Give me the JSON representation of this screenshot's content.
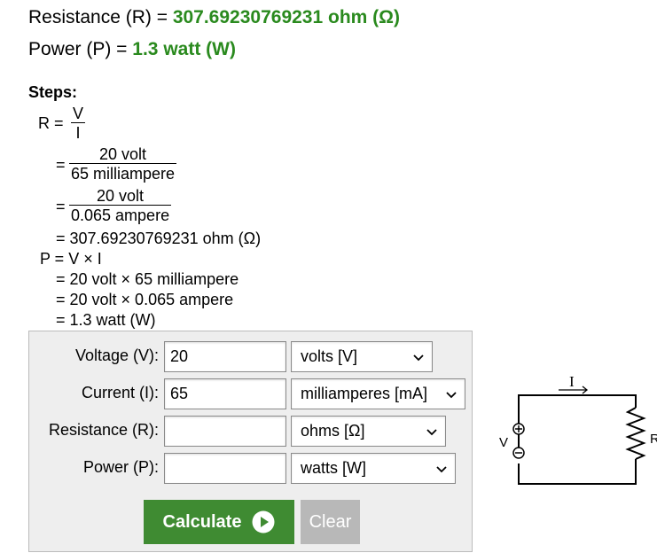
{
  "results": {
    "resistance_label": "Resistance (R) = ",
    "resistance_value": "307.69230769231 ohm (Ω)",
    "power_label": "Power (P) = ",
    "power_value": "1.3 watt (W)"
  },
  "steps": {
    "title": "Steps:",
    "r_prefix": "R =",
    "r_frac_num": "V",
    "r_frac_den": "I",
    "eq": "=",
    "f1_num": "20 volt",
    "f1_den": "65 milliampere",
    "f2_num": "20 volt",
    "f2_den": "0.065 ampere",
    "r_result": "= 307.69230769231 ohm (Ω)",
    "p_formula": "P = V × I",
    "p_step1": "= 20 volt × 65 milliampere",
    "p_step2": "= 20 volt × 0.065 ampere",
    "p_result": "= 1.3 watt (W)"
  },
  "form": {
    "voltage_label": "Voltage (V):",
    "voltage_value": "20",
    "voltage_unit": "volts [V]",
    "current_label": "Current (I):",
    "current_value": "65",
    "current_unit": "milliamperes [mA]",
    "resistance_label": "Resistance (R):",
    "resistance_value": "",
    "resistance_unit": "ohms [Ω]",
    "power_label": "Power (P):",
    "power_value": "",
    "power_unit": "watts [W]",
    "calculate_label": "Calculate",
    "clear_label": "Clear"
  },
  "diagram": {
    "current_label": "I",
    "voltage_label": "V",
    "resistor_label": "R"
  },
  "colors": {
    "result_green": "#2a8a1e",
    "calculate_bg": "#3f8b32",
    "clear_bg": "#b8b8b8",
    "panel_bg": "#eeeeee"
  }
}
